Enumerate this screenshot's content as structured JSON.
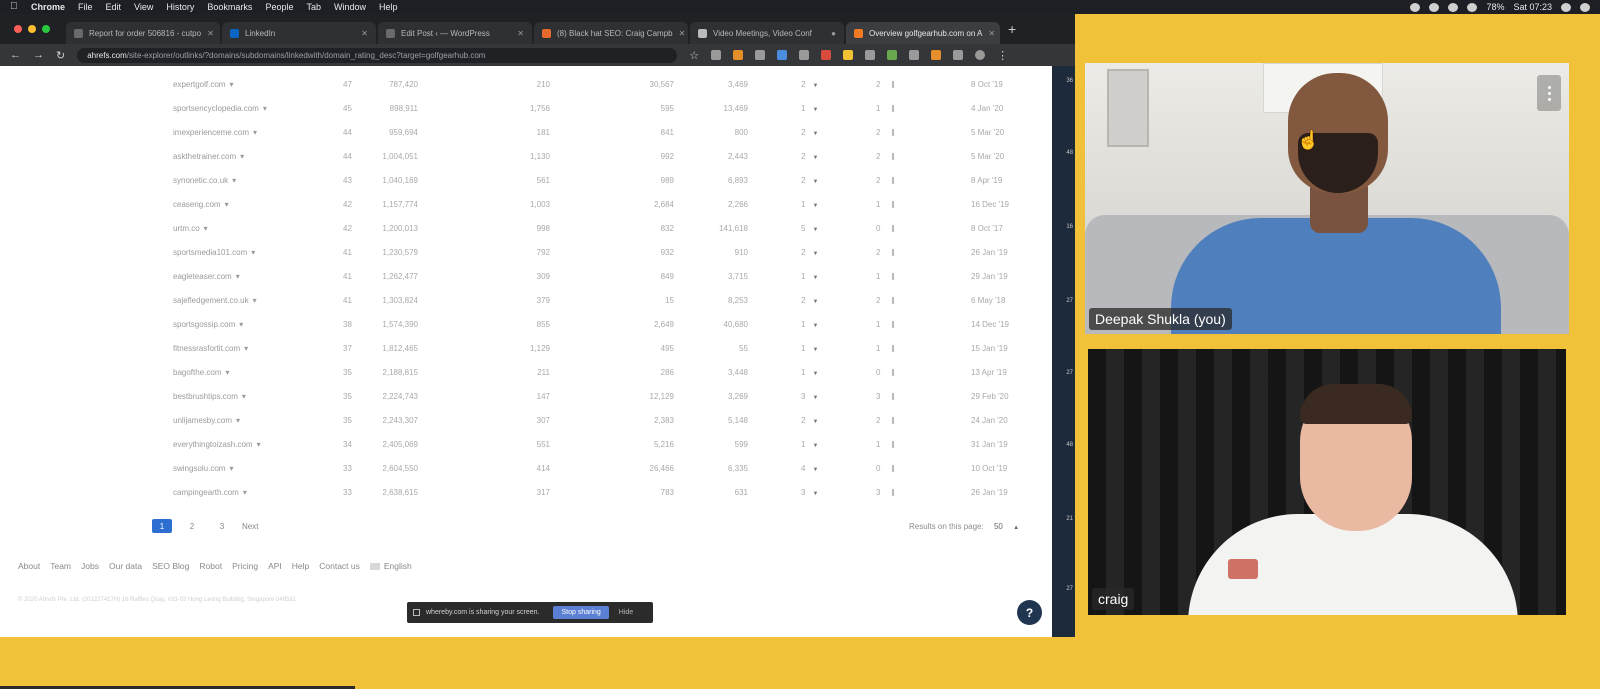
{
  "menubar": {
    "items": [
      "Chrome",
      "File",
      "Edit",
      "View",
      "History",
      "Bookmarks",
      "People",
      "Tab",
      "Window",
      "Help"
    ],
    "battery": "78%",
    "clock": "Sat 07:23"
  },
  "browser": {
    "tabs": [
      {
        "title": "Report for order 506816 - cutpo"
      },
      {
        "title": "LinkedIn"
      },
      {
        "title": "Edit Post ‹ — WordPress"
      },
      {
        "title": "(8) Black hat SEO: Craig Campb"
      },
      {
        "title": "Video Meetings, Video Conf"
      },
      {
        "title": "Overview golfgearhub.com on A"
      }
    ],
    "new_tab": "+",
    "url_host": "ahrefs.com",
    "url_path": "/site-explorer/outlinks/?domains/subdomains/linkedwith/domain_rating_desc?target=golfgearhub.com"
  },
  "table": {
    "rows": [
      {
        "domain": "expertgolf.com",
        "dr": "47",
        "ar": "787,420",
        "a": "210",
        "b": "30,567",
        "c": "3,469",
        "d": "2",
        "e": "2",
        "date": "8 Oct '19"
      },
      {
        "domain": "sportsencyclopedia.com",
        "dr": "45",
        "ar": "898,911",
        "a": "1,756",
        "b": "595",
        "c": "13,469",
        "d": "1",
        "e": "1",
        "date": "4 Jan '20"
      },
      {
        "domain": "imexperienceme.com",
        "dr": "44",
        "ar": "959,694",
        "a": "181",
        "b": "841",
        "c": "800",
        "d": "2",
        "e": "2",
        "date": "5 Mar '20"
      },
      {
        "domain": "askthetrainer.com",
        "dr": "44",
        "ar": "1,004,051",
        "a": "1,130",
        "b": "992",
        "c": "2,443",
        "d": "2",
        "e": "2",
        "date": "5 Mar '20"
      },
      {
        "domain": "synonetic.co.uk",
        "dr": "43",
        "ar": "1,040,169",
        "a": "561",
        "b": "989",
        "c": "6,893",
        "d": "2",
        "e": "2",
        "date": "8 Apr '19"
      },
      {
        "domain": "ceaseng.com",
        "dr": "42",
        "ar": "1,157,774",
        "a": "1,003",
        "b": "2,684",
        "c": "2,266",
        "d": "1",
        "e": "1",
        "date": "16 Dec '19"
      },
      {
        "domain": "urtm.co",
        "dr": "42",
        "ar": "1,200,013",
        "a": "998",
        "b": "832",
        "c": "141,618",
        "d": "5",
        "e": "0",
        "date": "8 Oct '17"
      },
      {
        "domain": "sportsmedia101.com",
        "dr": "41",
        "ar": "1,230,579",
        "a": "792",
        "b": "932",
        "c": "910",
        "d": "2",
        "e": "2",
        "date": "26 Jan '19"
      },
      {
        "domain": "eagleteaser.com",
        "dr": "41",
        "ar": "1,262,477",
        "a": "309",
        "b": "849",
        "c": "3,715",
        "d": "1",
        "e": "1",
        "date": "29 Jan '19"
      },
      {
        "domain": "sajefledgement.co.uk",
        "dr": "41",
        "ar": "1,303,824",
        "a": "379",
        "b": "15",
        "c": "8,253",
        "d": "2",
        "e": "2",
        "date": "6 May '18"
      },
      {
        "domain": "sportsgossip.com",
        "dr": "38",
        "ar": "1,574,390",
        "a": "855",
        "b": "2,649",
        "c": "40,680",
        "d": "1",
        "e": "1",
        "date": "14 Dec '19"
      },
      {
        "domain": "fitnessrasfortit.com",
        "dr": "37",
        "ar": "1,812,465",
        "a": "1,129",
        "b": "495",
        "c": "55",
        "d": "1",
        "e": "1",
        "date": "15 Jan '19"
      },
      {
        "domain": "bagofthe.com",
        "dr": "35",
        "ar": "2,188,815",
        "a": "211",
        "b": "286",
        "c": "3,448",
        "d": "1",
        "e": "0",
        "date": "13 Apr '19"
      },
      {
        "domain": "bestbrushtips.com",
        "dr": "35",
        "ar": "2,224,743",
        "a": "147",
        "b": "12,129",
        "c": "3,269",
        "d": "3",
        "e": "3",
        "date": "29 Feb '20"
      },
      {
        "domain": "unlijamesby.com",
        "dr": "35",
        "ar": "2,243,307",
        "a": "307",
        "b": "2,383",
        "c": "5,148",
        "d": "2",
        "e": "2",
        "date": "24 Jan '20"
      },
      {
        "domain": "everythingtoizash.com",
        "dr": "34",
        "ar": "2,405,069",
        "a": "551",
        "b": "5,216",
        "c": "599",
        "d": "1",
        "e": "1",
        "date": "31 Jan '19"
      },
      {
        "domain": "swingsolu.com",
        "dr": "33",
        "ar": "2,604,550",
        "a": "414",
        "b": "26,466",
        "c": "6,335",
        "d": "4",
        "e": "0",
        "date": "10 Oct '19"
      },
      {
        "domain": "campingearth.com",
        "dr": "33",
        "ar": "2,638,615",
        "a": "317",
        "b": "783",
        "c": "631",
        "d": "3",
        "e": "3",
        "date": "26 Jan '19"
      }
    ]
  },
  "pagination": {
    "pages": [
      "1",
      "2",
      "3"
    ],
    "next": "Next",
    "results_label": "Results on this page:",
    "results_value": "50"
  },
  "footer": {
    "links": [
      "About",
      "Team",
      "Jobs",
      "Our data",
      "SEO Blog",
      "Robot",
      "Pricing",
      "API",
      "Help",
      "Contact us"
    ],
    "language": "English",
    "copyright": "© 2020 Ahrefs Pte. Ltd. (201227417H) 16 Raffles Quay, #33-03 Hong Leong Building, Singapore 048581"
  },
  "sharing_bar": {
    "message": "whereby.com is sharing your screen.",
    "stop": "Stop sharing",
    "hide": "Hide"
  },
  "help_button": "?",
  "side_ticks": [
    "36",
    "48",
    "16",
    "27",
    "27",
    "48",
    "21",
    "27"
  ],
  "video": {
    "participant1": "Deepak Shukla (you)",
    "participant2": "craig"
  },
  "colors": {
    "accent": "#2d6fd1",
    "call_background": "#f2c13a",
    "stop_button": "#5b7fd3"
  }
}
